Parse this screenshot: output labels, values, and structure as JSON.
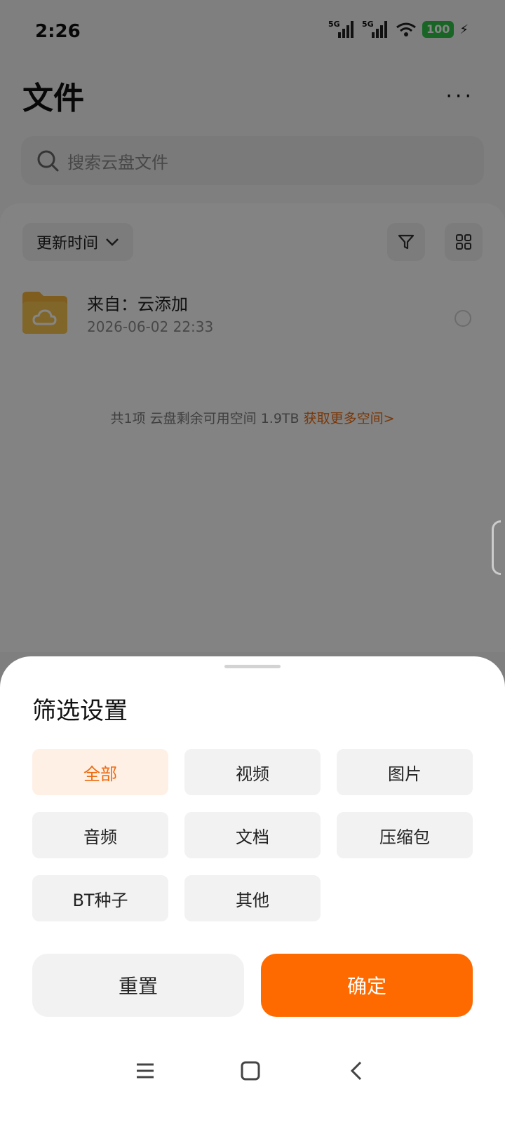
{
  "status": {
    "time": "2:26",
    "net1": "5G",
    "net2": "5G",
    "battery": "100"
  },
  "header": {
    "title": "文件",
    "more_label": "···"
  },
  "search": {
    "placeholder": "搜索云盘文件"
  },
  "list": {
    "sort_label": "更新时间",
    "items": [
      {
        "name": "来自：云添加",
        "date": "2026-06-02 22:33"
      }
    ],
    "summary": {
      "count": "共1项",
      "storage": "云盘剩余可用空间",
      "size": "1.9TB",
      "link": "获取更多空间>"
    }
  },
  "sheet": {
    "title": "筛选设置",
    "options": [
      {
        "label": "全部",
        "selected": true
      },
      {
        "label": "视频",
        "selected": false
      },
      {
        "label": "图片",
        "selected": false
      },
      {
        "label": "音频",
        "selected": false
      },
      {
        "label": "文档",
        "selected": false
      },
      {
        "label": "压缩包",
        "selected": false
      },
      {
        "label": "BT种子",
        "selected": false
      },
      {
        "label": "其他",
        "selected": false
      }
    ],
    "reset_label": "重置",
    "confirm_label": "确定"
  },
  "colors": {
    "accent": "#ff6a00",
    "accent_soft": "#fff0e6",
    "battery": "#30c14a"
  },
  "icons": [
    "search-icon",
    "filter-icon",
    "grid-view-icon",
    "folder-cloud-icon",
    "chevron-down-icon",
    "menu-icon",
    "home-icon",
    "back-icon",
    "more-icon"
  ]
}
